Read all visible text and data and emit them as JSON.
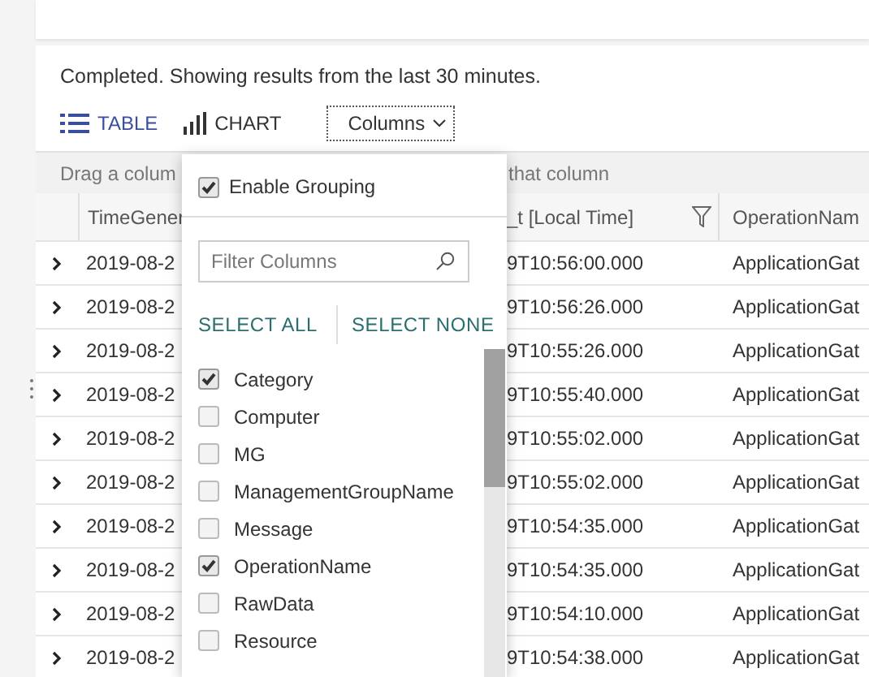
{
  "status": "Completed. Showing results from the last 30 minutes.",
  "view_tabs": [
    {
      "label": "TABLE",
      "kind": "table",
      "selected": true
    },
    {
      "label": "CHART",
      "kind": "chart",
      "selected": false
    }
  ],
  "columns_button": {
    "label": "Columns"
  },
  "group_bar": {
    "text_left": "Drag a colum",
    "text_right": "that column"
  },
  "table": {
    "columns": [
      "TimeGener",
      "_t [Local Time]",
      "OperationNam"
    ],
    "rows": [
      [
        "2019-08-2",
        "9T10:56:00.000",
        "ApplicationGat"
      ],
      [
        "2019-08-2",
        "9T10:56:26.000",
        "ApplicationGat"
      ],
      [
        "2019-08-2",
        "9T10:55:26.000",
        "ApplicationGat"
      ],
      [
        "2019-08-2",
        "9T10:55:40.000",
        "ApplicationGat"
      ],
      [
        "2019-08-2",
        "9T10:55:02.000",
        "ApplicationGat"
      ],
      [
        "2019-08-2",
        "9T10:55:02.000",
        "ApplicationGat"
      ],
      [
        "2019-08-2",
        "9T10:54:35.000",
        "ApplicationGat"
      ],
      [
        "2019-08-2",
        "9T10:54:35.000",
        "ApplicationGat"
      ],
      [
        "2019-08-2",
        "9T10:54:10.000",
        "ApplicationGat"
      ],
      [
        "2019-08-2",
        "9T10:54:38.000",
        "ApplicationGat"
      ]
    ]
  },
  "columns_menu": {
    "enable_grouping": {
      "label": "Enable Grouping",
      "checked": true
    },
    "filter": {
      "placeholder": "Filter Columns"
    },
    "select_all": "SELECT ALL",
    "select_none": "SELECT NONE",
    "items": [
      {
        "label": "Category",
        "checked": true
      },
      {
        "label": "Computer",
        "checked": false
      },
      {
        "label": "MG",
        "checked": false
      },
      {
        "label": "ManagementGroupName",
        "checked": false
      },
      {
        "label": "Message",
        "checked": false
      },
      {
        "label": "OperationName",
        "checked": true
      },
      {
        "label": "RawData",
        "checked": false
      },
      {
        "label": "Resource",
        "checked": false
      }
    ]
  }
}
